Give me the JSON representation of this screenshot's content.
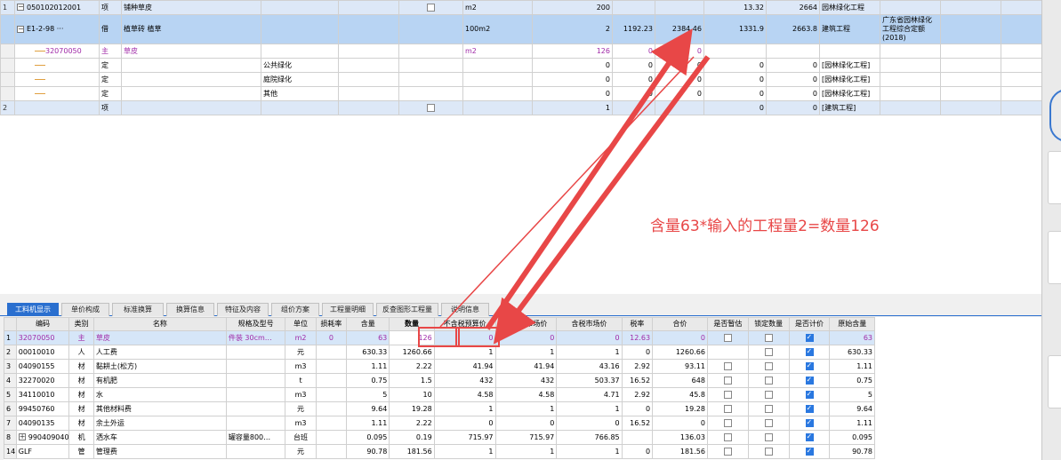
{
  "upper_rows": [
    {
      "rn": "1",
      "code": "050102012001",
      "type": "项",
      "name": "铺种草皮",
      "c4": "",
      "c5": "",
      "unit": "m2",
      "qty": "200",
      "p1": "",
      "p2": "",
      "p3": "13.32",
      "p4": "2664",
      "major": "园林绿化工程",
      "note": "",
      "style": "blue"
    },
    {
      "rn": "",
      "code": "E1-2-98",
      "type": "借",
      "name": "植草砖 植草",
      "c4": "",
      "c5": "",
      "unit": "100m2",
      "qty": "2",
      "p1": "1192.23",
      "p2": "2384.46",
      "p3": "1331.9",
      "p4": "2663.8",
      "major": "建筑工程",
      "note": "广东省园林绿化工程综合定额(2018)",
      "style": "sel"
    },
    {
      "rn": "",
      "code": "32070050",
      "type": "主",
      "name": "草皮",
      "c4": "",
      "c5": "",
      "unit": "m2",
      "qty": "126",
      "p1": "0",
      "p2": "0",
      "p3": "",
      "p4": "",
      "major": "",
      "note": "",
      "style": "purple"
    },
    {
      "rn": "",
      "code": "",
      "type": "定",
      "name": "",
      "c4": "公共绿化",
      "c5": "",
      "unit": "",
      "qty": "0",
      "p1": "0",
      "p2": "0",
      "p3": "0",
      "p4": "0",
      "major": "[园林绿化工程]",
      "note": "",
      "style": ""
    },
    {
      "rn": "",
      "code": "",
      "type": "定",
      "name": "",
      "c4": "庭院绿化",
      "c5": "",
      "unit": "",
      "qty": "0",
      "p1": "0",
      "p2": "0",
      "p3": "0",
      "p4": "0",
      "major": "[园林绿化工程]",
      "note": "",
      "style": ""
    },
    {
      "rn": "",
      "code": "",
      "type": "定",
      "name": "",
      "c4": "其他",
      "c5": "",
      "unit": "",
      "qty": "0",
      "p1": "0",
      "p2": "0",
      "p3": "0",
      "p4": "0",
      "major": "[园林绿化工程]",
      "note": "",
      "style": ""
    },
    {
      "rn": "2",
      "code": "",
      "type": "项",
      "name": "",
      "c4": "",
      "c5": "",
      "unit": "",
      "qty": "1",
      "p1": "",
      "p2": "",
      "p3": "0",
      "p4": "0",
      "major": "[建筑工程]",
      "note": "",
      "style": "blue"
    }
  ],
  "annotation": "含量63*输入的工程量2=数量126",
  "tabs": [
    "工料机显示",
    "单价构成",
    "标准换算",
    "换算信息",
    "特征及内容",
    "组价方案",
    "工程量明细",
    "反查图形工程量",
    "说明信息"
  ],
  "columns": [
    "编码",
    "类别",
    "名称",
    "规格及型号",
    "单位",
    "损耗率",
    "含量",
    "数量",
    "不含税预算价",
    "不含税市场价",
    "含税市场价",
    "税率",
    "合价",
    "是否暂估",
    "锁定数量",
    "是否计价",
    "原始含量"
  ],
  "lower_rows": [
    {
      "rn": "1",
      "code": "32070050",
      "type": "主",
      "name": "草皮",
      "spec": "件装 30cm…",
      "unit": "m2",
      "loss": "0",
      "content": "63",
      "qty": "126",
      "p1": "0",
      "p2": "0",
      "p3": "0",
      "tax": "12.63",
      "total": "0",
      "est": false,
      "lock": false,
      "price": true,
      "orig": "63",
      "sel": true
    },
    {
      "rn": "2",
      "code": "00010010",
      "type": "人",
      "name": "人工费",
      "spec": "",
      "unit": "元",
      "loss": "",
      "content": "630.33",
      "qty": "1260.66",
      "p1": "1",
      "p2": "1",
      "p3": "1",
      "tax": "0",
      "total": "1260.66",
      "est": null,
      "lock": false,
      "price": true,
      "orig": "630.33",
      "sel": false
    },
    {
      "rn": "3",
      "code": "04090155",
      "type": "材",
      "name": "黏耕土(松方)",
      "spec": "",
      "unit": "m3",
      "loss": "",
      "content": "1.11",
      "qty": "2.22",
      "p1": "41.94",
      "p2": "41.94",
      "p3": "43.16",
      "tax": "2.92",
      "total": "93.11",
      "est": false,
      "lock": false,
      "price": true,
      "orig": "1.11",
      "sel": false
    },
    {
      "rn": "4",
      "code": "32270020",
      "type": "材",
      "name": "有机肥",
      "spec": "",
      "unit": "t",
      "loss": "",
      "content": "0.75",
      "qty": "1.5",
      "p1": "432",
      "p2": "432",
      "p3": "503.37",
      "tax": "16.52",
      "total": "648",
      "est": false,
      "lock": false,
      "price": true,
      "orig": "0.75",
      "sel": false
    },
    {
      "rn": "5",
      "code": "34110010",
      "type": "材",
      "name": "水",
      "spec": "",
      "unit": "m3",
      "loss": "",
      "content": "5",
      "qty": "10",
      "p1": "4.58",
      "p2": "4.58",
      "p3": "4.71",
      "tax": "2.92",
      "total": "45.8",
      "est": false,
      "lock": false,
      "price": true,
      "orig": "5",
      "sel": false
    },
    {
      "rn": "6",
      "code": "99450760",
      "type": "材",
      "name": "其他材料费",
      "spec": "",
      "unit": "元",
      "loss": "",
      "content": "9.64",
      "qty": "19.28",
      "p1": "1",
      "p2": "1",
      "p3": "1",
      "tax": "0",
      "total": "19.28",
      "est": false,
      "lock": false,
      "price": true,
      "orig": "9.64",
      "sel": false
    },
    {
      "rn": "7",
      "code": "04090135",
      "type": "材",
      "name": "余土外运",
      "spec": "",
      "unit": "m3",
      "loss": "",
      "content": "1.11",
      "qty": "2.22",
      "p1": "0",
      "p2": "0",
      "p3": "0",
      "tax": "16.52",
      "total": "0",
      "est": false,
      "lock": false,
      "price": true,
      "orig": "1.11",
      "sel": false
    },
    {
      "rn": "8",
      "code": "990409040",
      "type": "机",
      "name": "洒水车",
      "spec": "罐容量800…",
      "unit": "台班",
      "loss": "",
      "content": "0.095",
      "qty": "0.19",
      "p1": "715.97",
      "p2": "715.97",
      "p3": "766.85",
      "tax": "",
      "total": "136.03",
      "est": false,
      "lock": false,
      "price": true,
      "orig": "0.095",
      "sel": false,
      "expand": true
    },
    {
      "rn": "14",
      "code": "GLF",
      "type": "管",
      "name": "管理费",
      "spec": "",
      "unit": "元",
      "loss": "",
      "content": "90.78",
      "qty": "181.56",
      "p1": "1",
      "p2": "1",
      "p3": "1",
      "tax": "0",
      "total": "181.56",
      "est": false,
      "lock": false,
      "price": true,
      "orig": "90.78",
      "sel": false
    }
  ],
  "colors": {
    "accent": "#2a6fcf",
    "annotation": "#e84747",
    "purple": "#a02aa8",
    "selected": "#b8d4f3"
  }
}
